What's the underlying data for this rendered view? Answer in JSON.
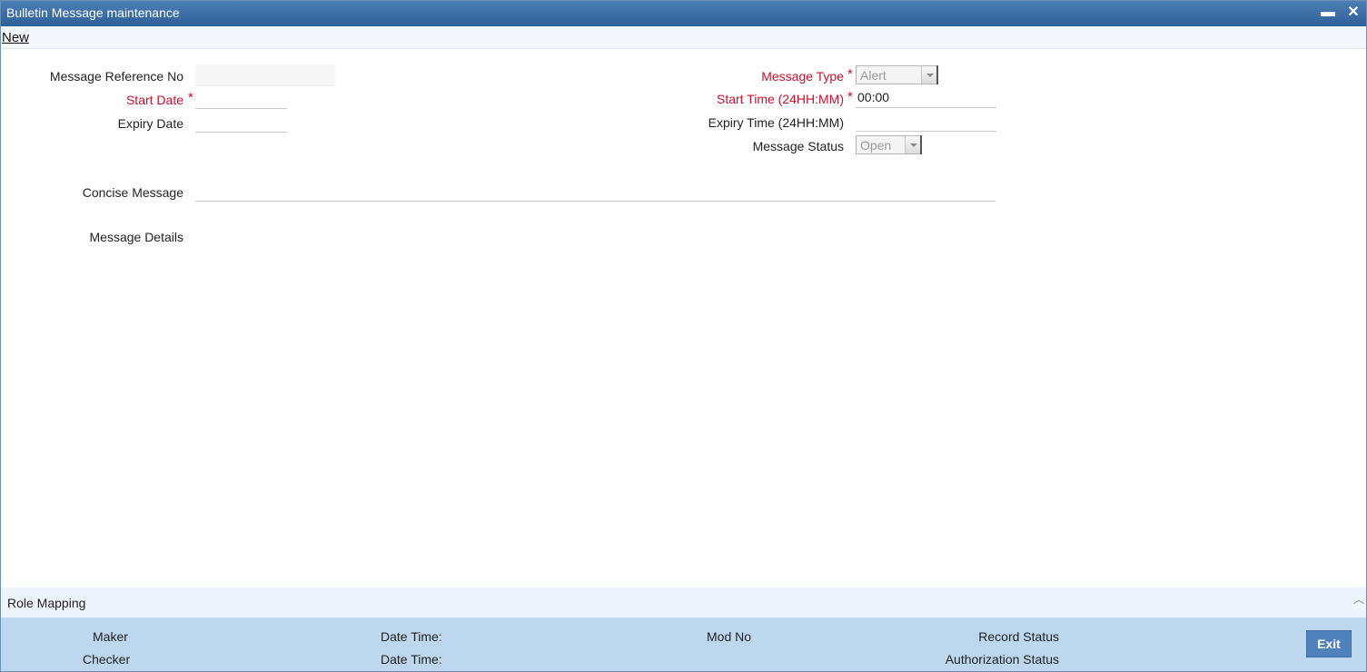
{
  "window": {
    "title": "Bulletin Message maintenance",
    "minimize_glyph": "▬",
    "close_glyph": "✕"
  },
  "menu": {
    "new_label": "New"
  },
  "form": {
    "message_reference_no": {
      "label": "Message Reference No",
      "value": ""
    },
    "start_date": {
      "label": "Start Date",
      "required_mark": "*",
      "value": ""
    },
    "expiry_date": {
      "label": "Expiry Date",
      "value": ""
    },
    "message_type": {
      "label": "Message Type",
      "required_mark": "*",
      "value": "Alert"
    },
    "start_time": {
      "label": "Start Time (24HH:MM)",
      "required_mark": "*",
      "value": "00:00"
    },
    "expiry_time": {
      "label": "Expiry Time (24HH:MM)",
      "value": ""
    },
    "message_status": {
      "label": "Message Status",
      "value": "Open"
    },
    "concise_message": {
      "label": "Concise Message",
      "value": ""
    },
    "message_details": {
      "label": "Message Details",
      "value": ""
    }
  },
  "role_mapping": {
    "label": "Role Mapping",
    "expand_icon": "chevron-up-icon",
    "expand_glyph": "︿"
  },
  "footer": {
    "maker_label": "Maker",
    "checker_label": "Checker",
    "maker_datetime_label": "Date Time:",
    "checker_datetime_label": "Date Time:",
    "mod_no_label": "Mod No",
    "record_status_label": "Record Status",
    "authorization_status_label": "Authorization Status",
    "exit_label": "Exit"
  },
  "colors": {
    "title_bar": "#3d6ea6",
    "required_label": "#c8102e",
    "footer_bg": "#bdd7ee",
    "exit_button": "#4f81bd"
  }
}
